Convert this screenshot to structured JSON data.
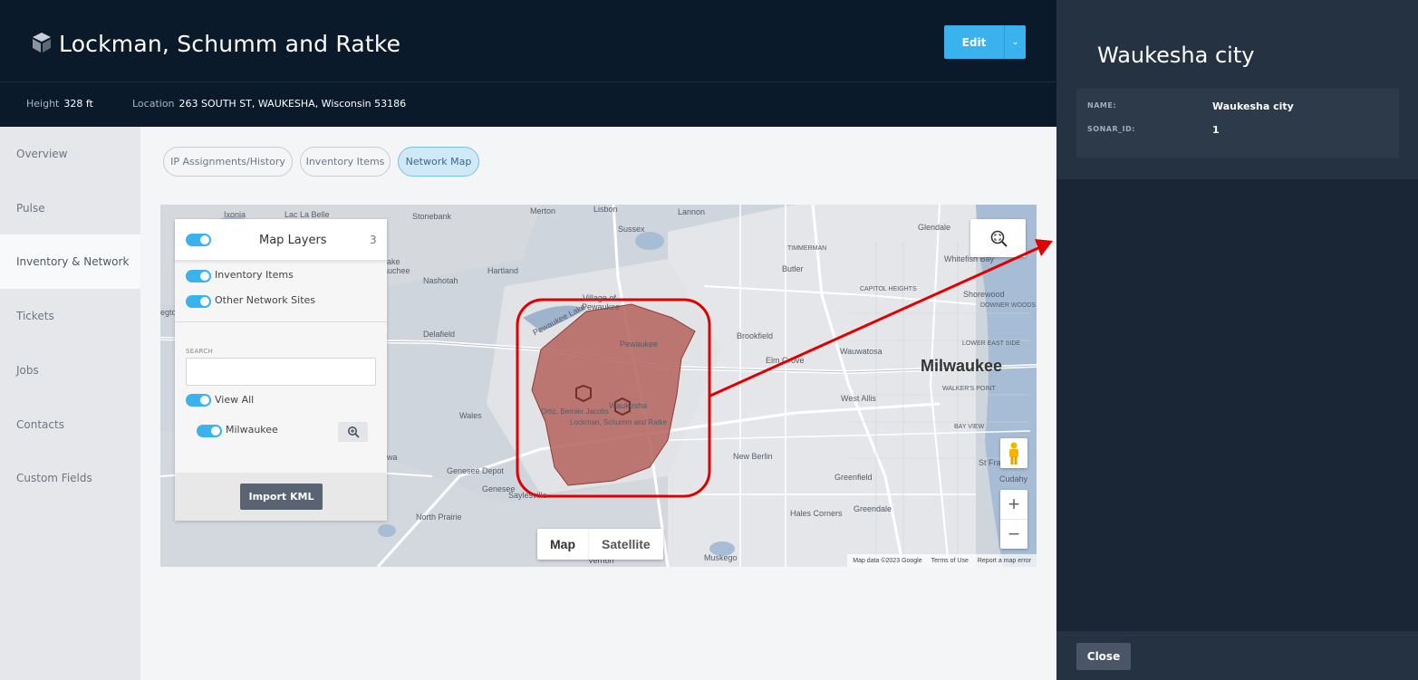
{
  "header": {
    "title": "Lockman, Schumm and Ratke",
    "edit_label": "Edit",
    "meta": [
      {
        "key": "Height",
        "value": "328 ft"
      },
      {
        "key": "Location",
        "value": "263 SOUTH ST, WAUKESHA, Wisconsin 53186"
      }
    ]
  },
  "sidebar": {
    "items": [
      {
        "label": "Overview"
      },
      {
        "label": "Pulse"
      },
      {
        "label": "Inventory & Network",
        "active": true
      },
      {
        "label": "Tickets"
      },
      {
        "label": "Jobs"
      },
      {
        "label": "Contacts"
      },
      {
        "label": "Custom Fields"
      }
    ]
  },
  "tabs": [
    {
      "label": "IP Assignments/History"
    },
    {
      "label": "Inventory Items"
    },
    {
      "label": "Network Map",
      "active": true
    }
  ],
  "layers": {
    "title": "Map Layers",
    "count": "3",
    "inventory_items": "Inventory Items",
    "other_sites": "Other Network Sites",
    "search_label": "SEARCH",
    "search_value": "",
    "view_all": "View All",
    "layer_name": "Milwaukee",
    "import_label": "Import KML"
  },
  "map": {
    "type_map": "Map",
    "type_satellite": "Satellite",
    "attribution": [
      "Map data ©2023 Google",
      "Terms of Use",
      "Report a map error"
    ],
    "city_big": "Milwaukee",
    "labels": {
      "ixonia": "Ixonia",
      "lac_la_belle": "Lac La Belle",
      "stonebank": "Stonebank",
      "merton": "Merton",
      "lisbon": "Lisbon",
      "lannon": "Lannon",
      "sussex": "Sussex",
      "hartland": "Hartland",
      "nashotah": "Nashotah",
      "glendale": "Glendale",
      "whitefish_bay": "Whitefish Bay",
      "butler": "Butler",
      "shorewood": "Shorewood",
      "delafield": "Delafield",
      "pewaukee_lake": "Pewaukee Lake",
      "village_of_pewaukee": "Village of",
      "pewaukee": "Pewaukee",
      "pewaukee2": "Pewaukee",
      "brookfield": "Brookfield",
      "wauwatosa": "Wauwatosa",
      "elm_grove": "Elm Grove",
      "west_allis": "West Allis",
      "wales": "Wales",
      "ortiz": "Ortiz, Bernier Jacobs",
      "waukesha": "Waukesha",
      "lockman_map": "Lockman, Schumm and Ratke",
      "genesee_depot": "Genesee Depot",
      "genesee": "Genesee",
      "saylesville": "Saylesville",
      "north_prairie": "North Prairie",
      "new_berlin": "New Berlin",
      "greenfield": "Greenfield",
      "greendale": "Greendale",
      "hales_corners": "Hales Corners",
      "muskego": "Muskego",
      "vernon": "Vernon",
      "st_francis": "St Franc",
      "cudahy": "Cudahy",
      "bay_view": "BAY VIEW",
      "walkers_point": "WALKER'S POINT",
      "timmerman": "TIMMERMAN",
      "capitol_heights": "CAPITOL HEIGHTS",
      "east_side": "EAST SIDE",
      "downer_woods": "DOWNER WOODS",
      "lower_east_side": "LOWER EAST SIDE",
      "auchee": "auchee",
      "ake": "ake",
      "egto": "egto",
      "wa": "wa"
    }
  },
  "detail": {
    "title": "Waukesha city",
    "fields": [
      {
        "key": "NAME:",
        "value": "Waukesha city"
      },
      {
        "key": "SONAR_ID:",
        "value": "1"
      }
    ],
    "close_label": "Close"
  },
  "colors": {
    "header_bg": "#0b1a2b",
    "accent": "#3ab2ee",
    "polygon_fill": "#b5635c",
    "highlight": "#e10000",
    "panel_bg": "#1a2636"
  }
}
